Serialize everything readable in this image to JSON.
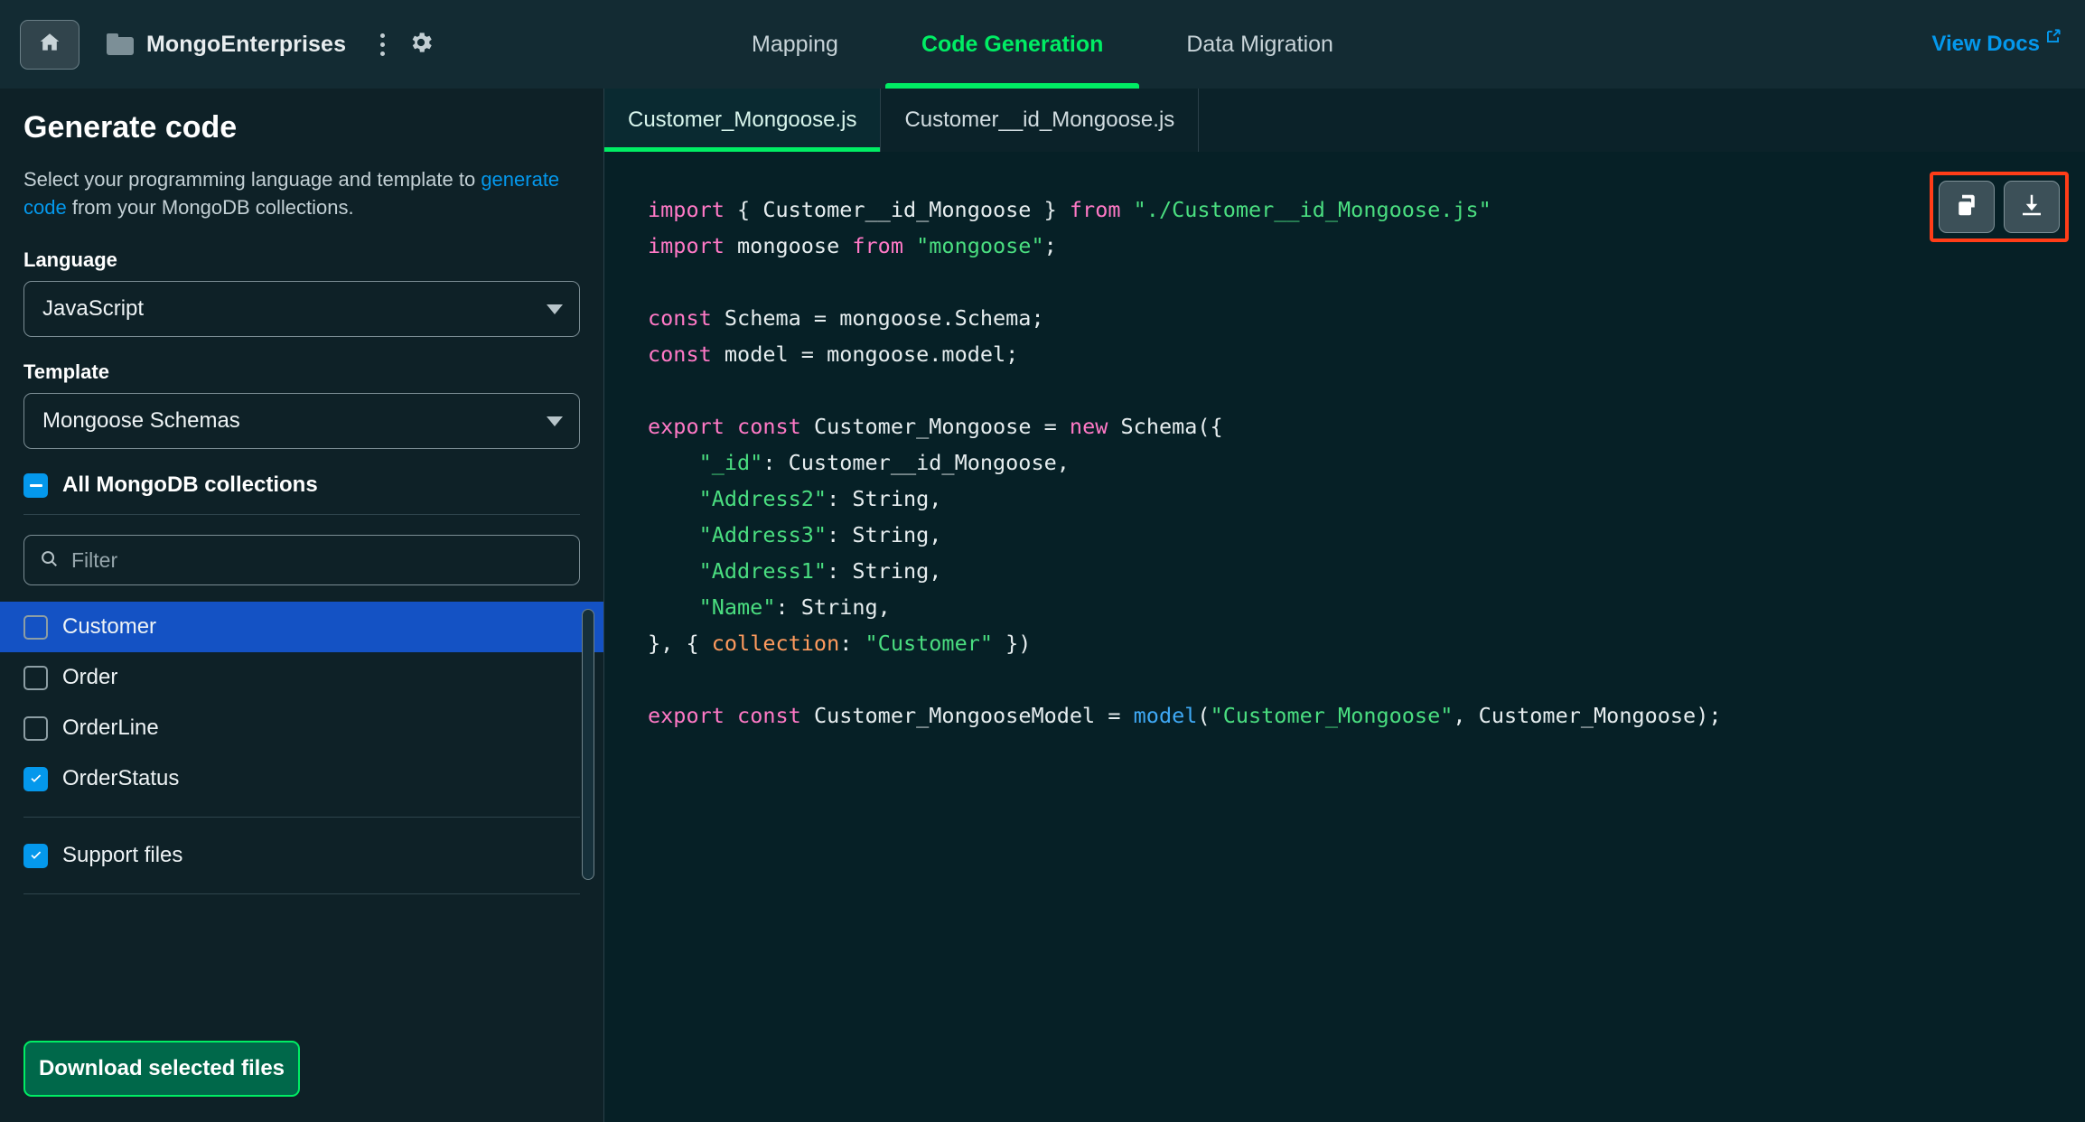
{
  "topbar": {
    "home_icon": "home-icon",
    "folder_icon": "folder-icon",
    "project_name": "MongoEnterprises",
    "kebab_icon": "more-vertical-icon",
    "gear_icon": "gear-icon",
    "tabs": [
      {
        "label": "Mapping",
        "active": false
      },
      {
        "label": "Code Generation",
        "active": true
      },
      {
        "label": "Data Migration",
        "active": false
      }
    ],
    "view_docs": {
      "label": "View Docs",
      "icon": "external-link-icon"
    }
  },
  "sidebar": {
    "title": "Generate code",
    "description_before": "Select your programming language and template to ",
    "description_link": "generate code",
    "description_after": " from your MongoDB collections.",
    "language": {
      "label": "Language",
      "value": "JavaScript"
    },
    "template": {
      "label": "Template",
      "value": "Mongoose Schemas"
    },
    "all_collections": {
      "label": "All MongoDB collections",
      "state": "indeterminate"
    },
    "filter": {
      "placeholder": "Filter",
      "value": "",
      "icon": "search-icon"
    },
    "collections": [
      {
        "label": "Customer",
        "checked": false,
        "selected": true
      },
      {
        "label": "Order",
        "checked": false,
        "selected": false
      },
      {
        "label": "OrderLine",
        "checked": false,
        "selected": false
      },
      {
        "label": "OrderStatus",
        "checked": true,
        "selected": false
      }
    ],
    "support_files": {
      "label": "Support files",
      "checked": true
    },
    "download_button": "Download selected files"
  },
  "editor": {
    "file_tabs": [
      {
        "label": "Customer_Mongoose.js",
        "active": true
      },
      {
        "label": "Customer__id_Mongoose.js",
        "active": false
      }
    ],
    "actions": [
      {
        "name": "copy-code-button",
        "icon": "copy-icon"
      },
      {
        "name": "download-file-button",
        "icon": "download-icon"
      }
    ],
    "code_lines": [
      "import { Customer__id_Mongoose } from \"./Customer__id_Mongoose.js\"",
      "import mongoose from \"mongoose\";",
      "",
      "const Schema = mongoose.Schema;",
      "const model = mongoose.model;",
      "",
      "export const Customer_Mongoose = new Schema({",
      "    \"_id\": Customer__id_Mongoose,",
      "    \"Address2\": String,",
      "    \"Address3\": String,",
      "    \"Address1\": String,",
      "    \"Name\": String,",
      "}, { collection: \"Customer\" })",
      "",
      "export const Customer_MongooseModel = model(\"Customer_Mongoose\", Customer_Mongoose);"
    ]
  },
  "colors": {
    "accent_green": "#00ed64",
    "link_blue": "#0498ec",
    "selection_blue": "#1452c4",
    "annotation_red": "#ff3d18",
    "topbar_bg": "#132b33",
    "sidebar_bg": "#0e2127",
    "editor_bg": "#062026"
  }
}
